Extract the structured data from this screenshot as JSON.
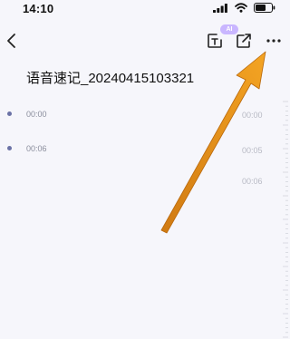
{
  "status_bar": {
    "time": "14:10",
    "signal_icon": "signal-bars-icon",
    "wifi_icon": "wifi-icon",
    "battery_icon": "battery-icon"
  },
  "toolbar": {
    "back_icon": "chevron-left-icon",
    "export_text_icon": "text-export-icon",
    "ai_badge": "AI",
    "share_icon": "share-icon",
    "more_icon": "ellipsis-icon"
  },
  "note": {
    "title": "语音速记_20240415103321",
    "segments": [
      {
        "time": "00:00"
      },
      {
        "time": "00:06"
      }
    ]
  },
  "timeline": {
    "labels": [
      "00:00",
      "00:05",
      "00:06"
    ]
  },
  "annotation": {
    "arrow_color": "#ef9a1c",
    "points_to": "more-button"
  },
  "colors": {
    "background": "#f6f6fb",
    "segment_dot": "#6b72a6",
    "ai_badge": "#c9b6ff"
  }
}
